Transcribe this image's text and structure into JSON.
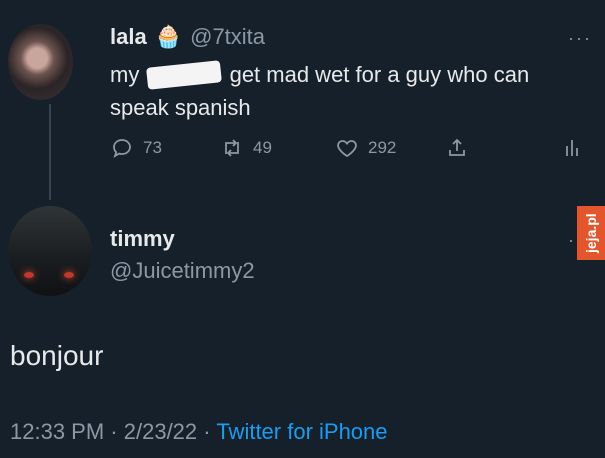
{
  "original_tweet": {
    "display_name": "lala",
    "name_emoji": "🧁",
    "handle": "@7txita",
    "text_prefix": "my",
    "text_suffix": "get mad wet for a guy who can speak spanish",
    "counts": {
      "replies": "73",
      "retweets": "49",
      "likes": "292"
    }
  },
  "reply_tweet": {
    "display_name": "timmy",
    "handle": "@Juicetimmy2",
    "text": "bonjour",
    "time": "12:33 PM",
    "date": "2/23/22",
    "source": "Twitter for iPhone"
  },
  "more_menu": "···",
  "watermark_text": "jeja.pl",
  "colors": {
    "background": "#15202b",
    "text": "#e7e9ea",
    "muted": "#8b98a5",
    "link": "#1d9bf0",
    "watermark": "#e2552d"
  }
}
